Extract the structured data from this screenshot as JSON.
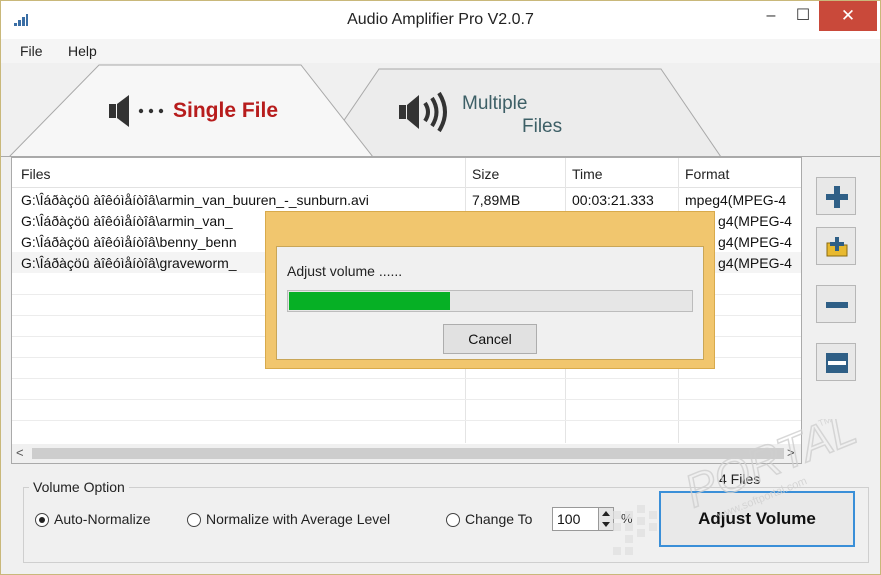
{
  "window": {
    "title": "Audio Amplifier Pro V2.0.7",
    "min_glyph": "–",
    "max_glyph": "☐",
    "close_glyph": "✕"
  },
  "menu": {
    "file": "File",
    "help": "Help"
  },
  "tabs": {
    "single": "Single File",
    "multiple_line1": "Multiple",
    "multiple_line2": "Files",
    "single_icon": "speaker-icon",
    "multiple_icon": "speaker-waves-icon"
  },
  "list": {
    "headers": {
      "files": "Files",
      "size": "Size",
      "time": "Time",
      "format": "Format"
    },
    "rows": [
      {
        "file": "G:\\Îáðàçöû àîêóìåíòîâ\\armin_van_buuren_-_sunburn.avi",
        "size": "7,89MB",
        "time": "00:03:21.333",
        "format": "mpeg4(MPEG-4"
      },
      {
        "file": "G:\\Îáðàçöû àîêóìåíòîâ\\armin_van_",
        "size": "",
        "time": "",
        "format": "g4(MPEG-4"
      },
      {
        "file": "G:\\Îáðàçöû àîêóìåíòîâ\\benny_benn",
        "size": "",
        "time": "",
        "format": "g4(MPEG-4"
      },
      {
        "file": "G:\\Îáðàçöû àîêóìåíòîâ\\graveworm_",
        "size": "",
        "time": "",
        "format": "g4(MPEG-4"
      }
    ],
    "scroll_left": "<",
    "scroll_right": ">"
  },
  "side_buttons": [
    "plus-icon",
    "add-folder-icon",
    "minus-icon",
    "clear-list-icon"
  ],
  "volume_option": {
    "title": "Volume Option",
    "auto_normalize": "Auto-Normalize",
    "normalize_average": "Normalize with Average Level",
    "change_to": "Change To",
    "change_value": "100",
    "percent": "%",
    "selected": "auto_normalize"
  },
  "files_count": "4 Files",
  "adjust_button": "Adjust Volume",
  "dialog": {
    "text": "Adjust volume ......",
    "progress": 0.4,
    "cancel": "Cancel"
  },
  "watermark": {
    "text": "PORTAL",
    "tm": "TM",
    "url": "www.softportal.com"
  },
  "colors": {
    "single_tab": "#b71c1c",
    "multiple_tab": "#3d5f66",
    "progress_fill": "#06b025",
    "dialog_frame": "#f1c66e",
    "close_button": "#c9493a",
    "adjust_border": "#3a8fd8"
  }
}
